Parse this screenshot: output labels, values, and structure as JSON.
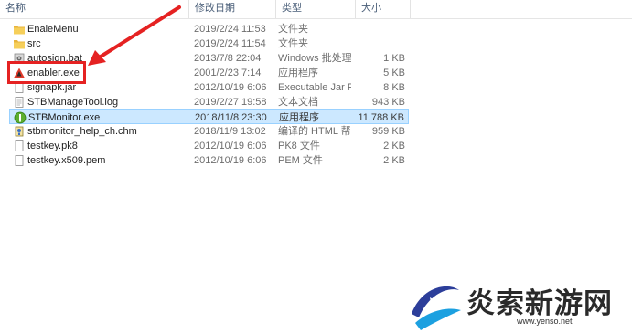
{
  "columns": {
    "name": "名称",
    "date": "修改日期",
    "type": "类型",
    "size": "大小"
  },
  "files": [
    {
      "icon": "folder-icon",
      "name": "EnaleMenu",
      "date": "2019/2/24 11:53",
      "type": "文件夹",
      "size": ""
    },
    {
      "icon": "folder-icon",
      "name": "src",
      "date": "2019/2/24 11:54",
      "type": "文件夹",
      "size": ""
    },
    {
      "icon": "batch-file-icon",
      "name": "autosign.bat",
      "date": "2013/7/8 22:04",
      "type": "Windows 批处理 ...",
      "size": "1 KB"
    },
    {
      "icon": "warning-exe-icon",
      "name": "enabler.exe",
      "date": "2001/2/23 7:14",
      "type": "应用程序",
      "size": "5 KB"
    },
    {
      "icon": "jar-file-icon",
      "name": "signapk.jar",
      "date": "2012/10/19 6:06",
      "type": "Executable Jar File",
      "size": "8 KB"
    },
    {
      "icon": "text-file-icon",
      "name": "STBManageTool.log",
      "date": "2019/2/27 19:58",
      "type": "文本文档",
      "size": "943 KB"
    },
    {
      "icon": "stb-monitor-icon",
      "name": "STBMonitor.exe",
      "date": "2018/11/8 23:30",
      "type": "应用程序",
      "size": "11,788 KB"
    },
    {
      "icon": "chm-help-icon",
      "name": "stbmonitor_help_ch.chm",
      "date": "2018/11/9 13:02",
      "type": "编译的 HTML 帮...",
      "size": "959 KB"
    },
    {
      "icon": "file-icon",
      "name": "testkey.pk8",
      "date": "2012/10/19 6:06",
      "type": "PK8 文件",
      "size": "2 KB"
    },
    {
      "icon": "file-icon",
      "name": "testkey.x509.pem",
      "date": "2012/10/19 6:06",
      "type": "PEM 文件",
      "size": "2 KB"
    }
  ],
  "selected_file": "STBMonitor.exe",
  "highlighted_file": "enabler.exe",
  "watermark": {
    "text": "炎索新游网",
    "url": "www.yenso.net"
  },
  "colors": {
    "highlight": "#e52222",
    "selection": "#cce8ff",
    "folder": "#e8b43c"
  }
}
